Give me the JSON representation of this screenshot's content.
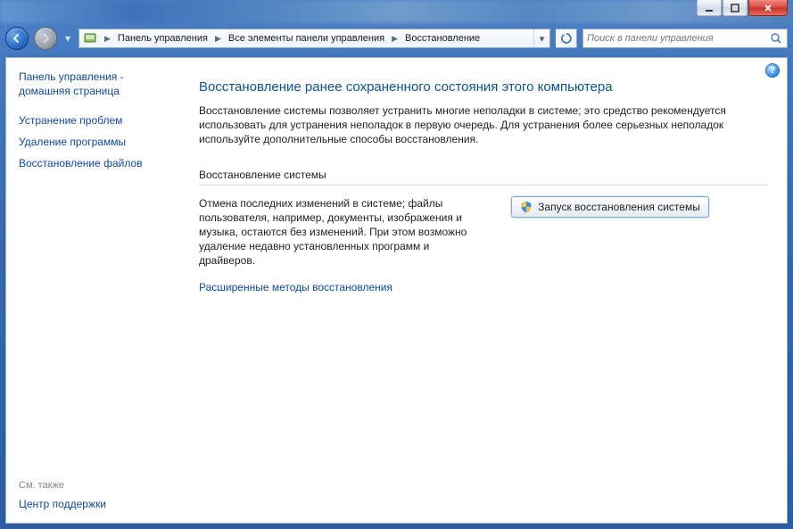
{
  "breadcrumb": {
    "item0": "Панель управления",
    "item1": "Все элементы панели управления",
    "item2": "Восстановление"
  },
  "search": {
    "placeholder": "Поиск в панели управления"
  },
  "sidebar": {
    "home": "Панель управления - домашняя страница",
    "link0": "Устранение проблем",
    "link1": "Удаление программы",
    "link2": "Восстановление файлов",
    "see_also_label": "См. также",
    "see_also_link": "Центр поддержки"
  },
  "main": {
    "title": "Восстановление ранее сохраненного состояния этого компьютера",
    "intro": "Восстановление системы позволяет устранить многие неполадки в системе; это средство рекомендуется использовать для устранения неполадок в первую очередь. Для устранения более серьезных неполадок используйте дополнительные способы восстановления.",
    "section_header": "Восстановление системы",
    "row_desc": "Отмена последних изменений в системе; файлы пользователя, например, документы, изображения и музыка, остаются без изменений. При этом возможно удаление недавно установленных программ и драйверов.",
    "action_button": "Запуск восстановления системы",
    "advanced_link": "Расширенные методы восстановления"
  },
  "help": {
    "glyph": "?"
  }
}
